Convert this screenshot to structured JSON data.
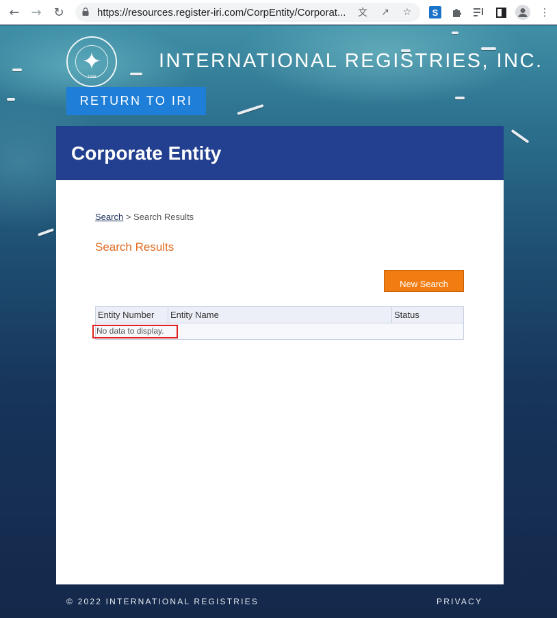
{
  "browser": {
    "url": "https://resources.register-iri.com/CorpEntity/Corporat...",
    "icons": {
      "back": "arrow-left",
      "forward": "arrow-right",
      "reload": "refresh",
      "lock": "lock",
      "translate": "translate",
      "share": "share",
      "bookmark": "star",
      "ext_s": "S",
      "extensions": "puzzle",
      "media": "media-queue",
      "sidepanel": "sidebar",
      "profile": "avatar",
      "menu": "kebab"
    }
  },
  "header": {
    "brand": "INTERNATIONAL REGISTRIES, INC.",
    "logo_year": "1948",
    "logo_text": "INTERNATIONAL REGISTRIES",
    "return_label": "RETURN TO IRI"
  },
  "panel": {
    "title": "Corporate Entity",
    "breadcrumb": {
      "link": "Search",
      "separator": " > ",
      "current": "Search Results"
    },
    "section_title": "Search Results",
    "new_search_label": "New Search",
    "grid": {
      "columns": [
        "Entity Number",
        "Entity Name",
        "Status"
      ],
      "empty_text": "No data to display."
    }
  },
  "footer": {
    "copyright": "© 2022 INTERNATIONAL REGISTRIES",
    "privacy": "PRIVACY"
  },
  "colors": {
    "header_bar": "#22408f",
    "return_button": "#1f7fd8",
    "accent_orange": "#f17d12",
    "section_title": "#e06a1f",
    "highlight": "#e02020"
  }
}
